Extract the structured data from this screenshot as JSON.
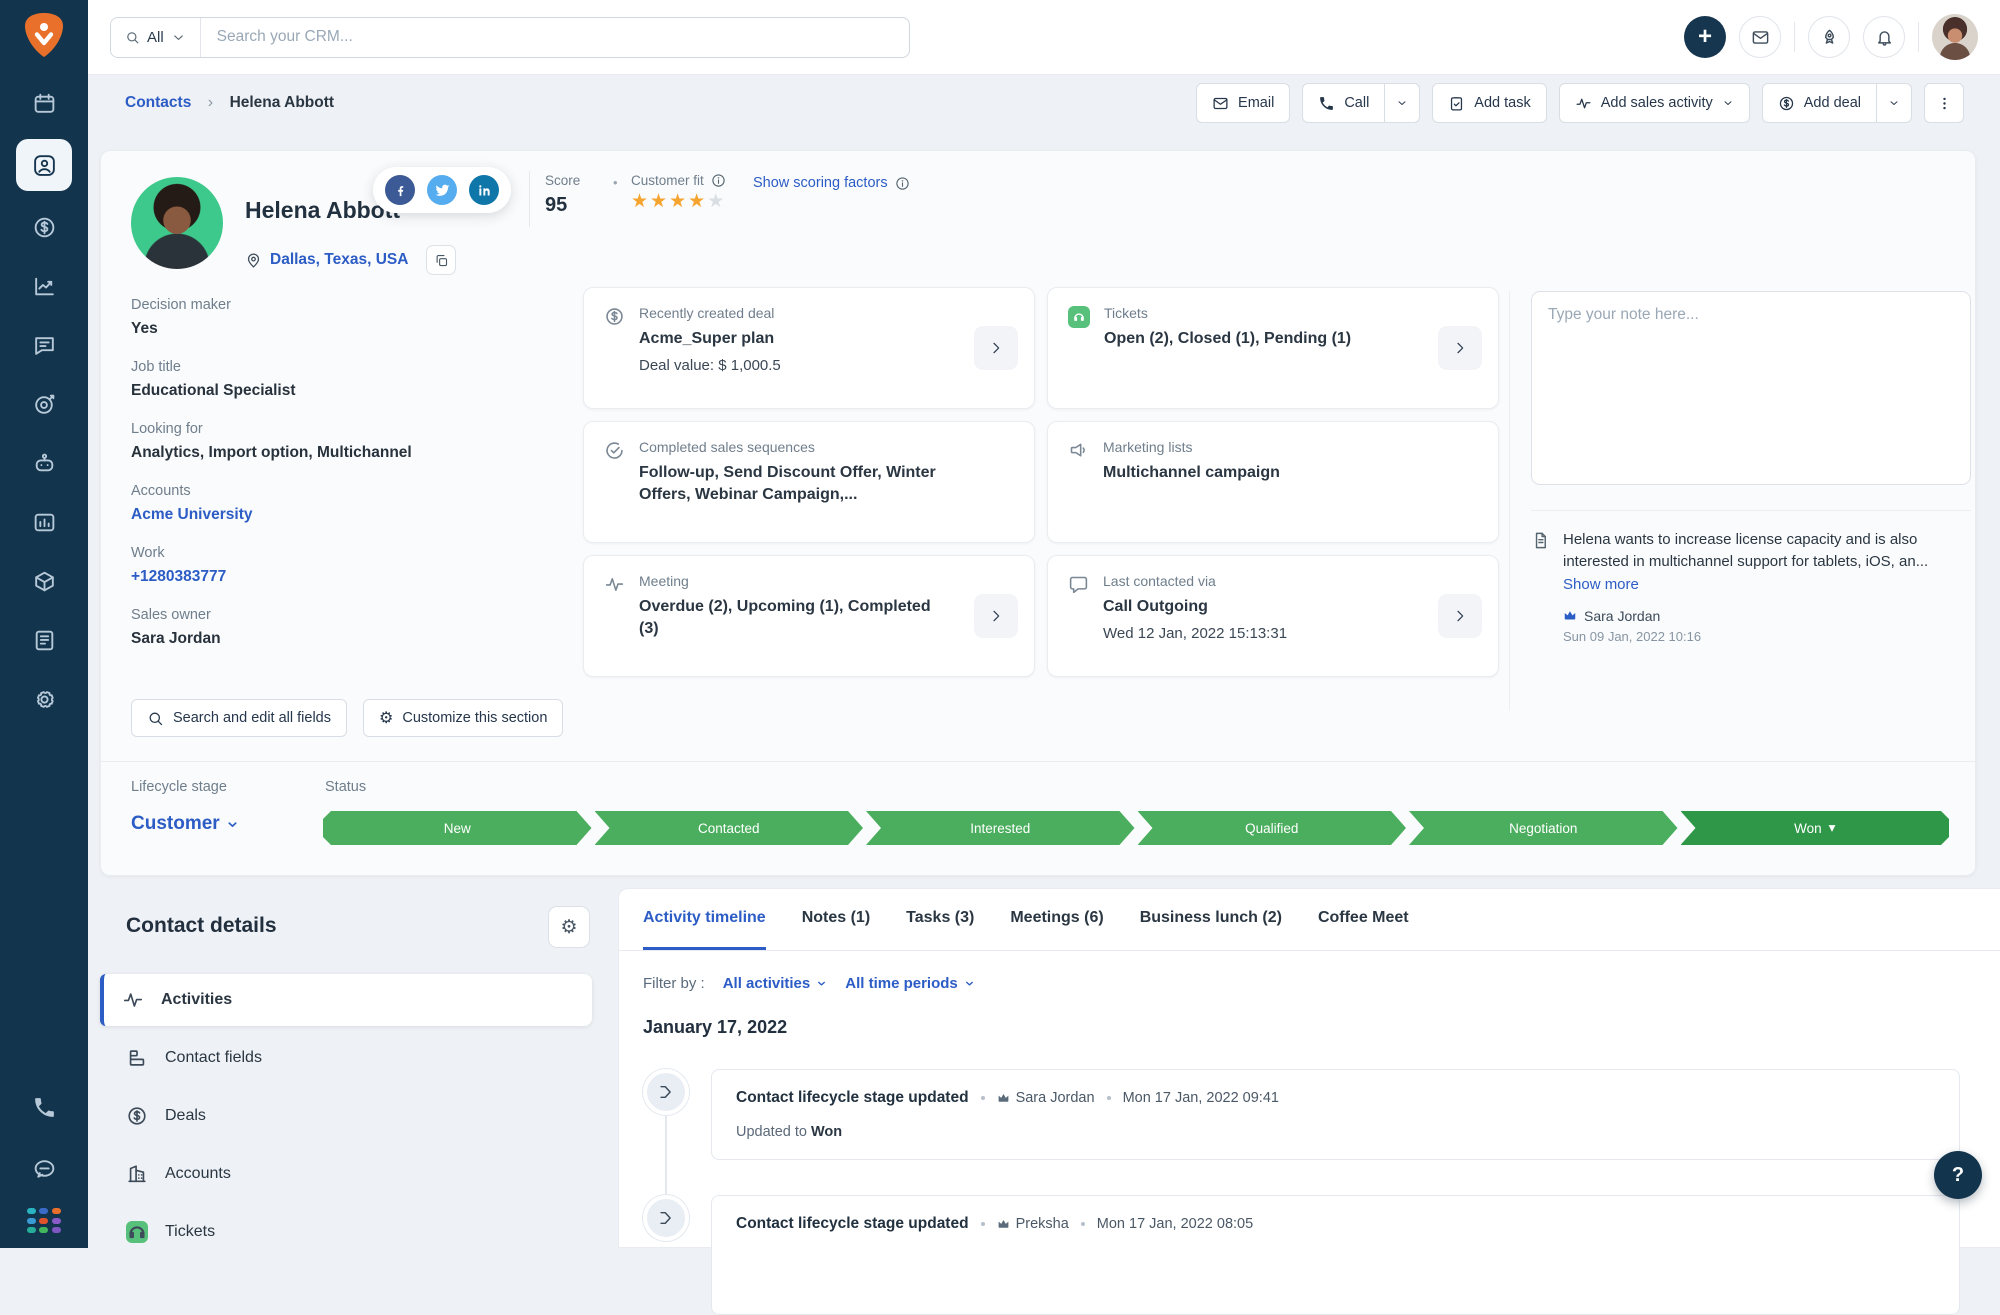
{
  "colors": {
    "navy": "#12344D",
    "blue": "#2C5CC5",
    "stage_green": "#4BAE5E",
    "won_green": "#2F9748",
    "star_orange": "#F6A430",
    "ticket_green": "#57C07B",
    "facebook": "#3C5A96",
    "twitter": "#55ACEE",
    "linkedin": "#0E76A8"
  },
  "sidebar": {
    "active": "contacts",
    "icons": [
      "calendar",
      "contacts",
      "deals",
      "analytics",
      "conversations",
      "goals",
      "automation",
      "reports",
      "products",
      "documents",
      "settings",
      "phone",
      "live-chat",
      "app-switcher"
    ],
    "app_grid_colors": [
      "#2AB3C0",
      "#3A6BC9",
      "#E8702A",
      "#3A9BD5",
      "#E0542C",
      "#8A5BC7",
      "#27AE9B",
      "#43B75D",
      "#7E57C2"
    ]
  },
  "topbar": {
    "search_scope": "All",
    "search_placeholder": "Search your CRM..."
  },
  "breadcrumb": {
    "parent": "Contacts",
    "separator": "›",
    "current": "Helena Abbott"
  },
  "actions": {
    "email": "Email",
    "call": "Call",
    "add_task": "Add task",
    "add_sales_activity": "Add sales activity",
    "add_deal": "Add deal"
  },
  "contact": {
    "name": "Helena Abbott",
    "location": "Dallas, Texas, USA",
    "score_label": "Score",
    "score_value": "95",
    "customer_fit_label": "Customer fit",
    "stars_filled": 4,
    "stars_total": 5,
    "scoring_link": "Show scoring factors",
    "fields": [
      {
        "label": "Decision maker",
        "value": "Yes"
      },
      {
        "label": "Job title",
        "value": "Educational Specialist"
      },
      {
        "label": "Looking for",
        "value": "Analytics, Import option, Multichannel"
      },
      {
        "label": "Accounts",
        "value": "Acme University"
      },
      {
        "label": "Work",
        "value": "+1280383777"
      },
      {
        "label": "Sales owner",
        "value": "Sara Jordan"
      }
    ]
  },
  "summary_cards": [
    {
      "title": "Recently created deal",
      "line1": "Acme_Super plan",
      "line2": "Deal value: $ 1,000.5"
    },
    {
      "title": "Tickets",
      "line1": "Open (2), Closed (1), Pending (1)"
    },
    {
      "title": "Completed sales sequences",
      "line1": "Follow-up, Send Discount Offer, Winter Offers, Webinar Campaign,..."
    },
    {
      "title": "Marketing lists",
      "line1": "Multichannel campaign"
    },
    {
      "title": "Meeting",
      "line1": "Overdue (2), Upcoming (1), Completed (3)"
    },
    {
      "title": "Last contacted via",
      "line1": "Call Outgoing",
      "line2": "Wed 12 Jan, 2022 15:13:31"
    }
  ],
  "notes": {
    "placeholder": "Type your note here...",
    "text": "Helena wants to increase license capacity and is also interested in multichannel support for tablets, iOS, an...",
    "show_more": "Show more",
    "author": "Sara Jordan",
    "timestamp": "Sun 09 Jan, 2022 10:16"
  },
  "section_actions": {
    "search_fields": "Search and edit all fields",
    "customize": "Customize this section"
  },
  "lifecycle": {
    "stage_label": "Lifecycle stage",
    "stage_value": "Customer",
    "status_label": "Status",
    "stages": [
      "New",
      "Contacted",
      "Interested",
      "Qualified",
      "Negotiation",
      "Won"
    ],
    "current_stage": "Won",
    "won_caret": "▾"
  },
  "contact_details": {
    "title": "Contact details",
    "items": [
      {
        "label": "Activities"
      },
      {
        "label": "Contact fields"
      },
      {
        "label": "Deals"
      },
      {
        "label": "Accounts"
      },
      {
        "label": "Tickets"
      }
    ],
    "active_item": "Activities"
  },
  "tabs": [
    {
      "label": "Activity timeline"
    },
    {
      "label": "Notes (1)"
    },
    {
      "label": "Tasks (3)"
    },
    {
      "label": "Meetings (6)"
    },
    {
      "label": "Business lunch (2)"
    },
    {
      "label": "Coffee Meet"
    }
  ],
  "active_tab": "Activity timeline",
  "filter": {
    "label": "Filter by :",
    "activities": "All activities",
    "periods": "All time periods"
  },
  "timeline": {
    "date_header": "January 17, 2022",
    "entries": [
      {
        "title": "Contact lifecycle stage updated",
        "author": "Sara Jordan",
        "time": "Mon 17 Jan, 2022 09:41",
        "body_prefix": "Updated to",
        "body_value": "Won"
      },
      {
        "title": "Contact lifecycle stage updated",
        "author": "Preksha",
        "time": "Mon 17 Jan, 2022 08:05"
      }
    ]
  },
  "help_label": "?",
  "separators": {
    "dot": "•",
    "caret": "▾"
  }
}
